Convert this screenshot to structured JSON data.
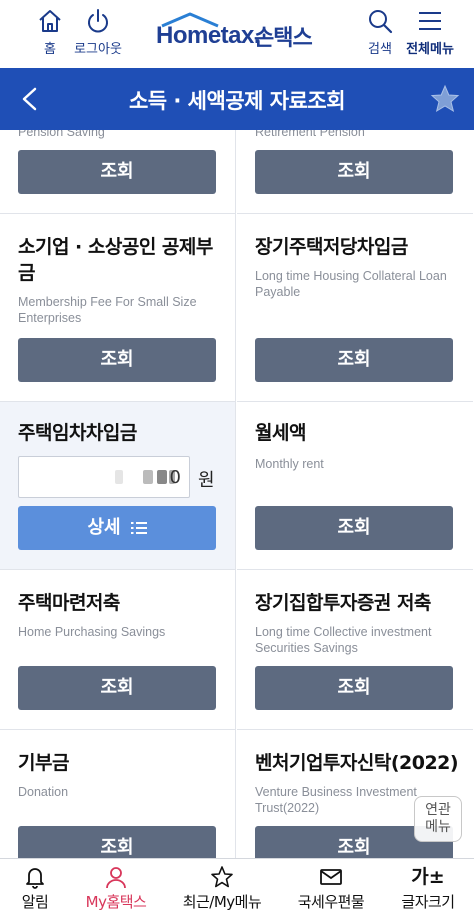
{
  "header": {
    "home_label": "홈",
    "logout_label": "로그아웃",
    "logo_en": "Hometax.",
    "logo_ko": "손택스",
    "search_label": "검색",
    "allmenu_label": "전체메뉴"
  },
  "titlebar": {
    "title": "소득 · 세액공제 자료조회"
  },
  "cells": {
    "pension_saving": {
      "sub": "Pension Saving",
      "button": "조회"
    },
    "retirement_pension": {
      "sub": "Retirement Pension",
      "button": "조회"
    },
    "small_business": {
      "title": "소기업 · 소상공인 공제부금",
      "sub": "Membership Fee For Small Size Enterprises",
      "button": "조회"
    },
    "long_housing": {
      "title": "장기주택저당차입금",
      "sub": "Long time Housing Collateral Loan Payable",
      "button": "조회"
    },
    "housing_loan": {
      "title": "주택임차차입금",
      "amount": "0",
      "unit": "원",
      "button": "상세"
    },
    "monthly_rent": {
      "title": "월세액",
      "sub": "Monthly rent",
      "button": "조회"
    },
    "housing_savings": {
      "title": "주택마련저축",
      "sub": "Home Purchasing Savings",
      "button": "조회"
    },
    "collective_invest": {
      "title": "장기집합투자증권 저축",
      "sub": "Long time Collective investment Securities Savings",
      "button": "조회"
    },
    "donation": {
      "title": "기부금",
      "sub": "Donation",
      "button": "조회"
    },
    "venture": {
      "title": "벤처기업투자신탁(2022)",
      "sub": "Venture Business Investment Trust(2022)",
      "button": "조회"
    }
  },
  "related_menu": {
    "line1": "연관",
    "line2": "메뉴"
  },
  "bottom_nav": {
    "items": [
      {
        "label": "알림",
        "icon": "bell-icon"
      },
      {
        "label": "My홈택스",
        "icon": "person-icon",
        "active": true
      },
      {
        "label": "최근/My메뉴",
        "icon": "star-icon"
      },
      {
        "label": "국세우편물",
        "icon": "mail-icon"
      },
      {
        "label": "글자크기",
        "icon": "font-size-icon",
        "glyph": "가±"
      }
    ]
  },
  "colors": {
    "brand_blue": "#1f4fb6",
    "view_button": "#5d6a80",
    "detail_button": "#5b8fdc",
    "active_nav": "#d8365a"
  }
}
